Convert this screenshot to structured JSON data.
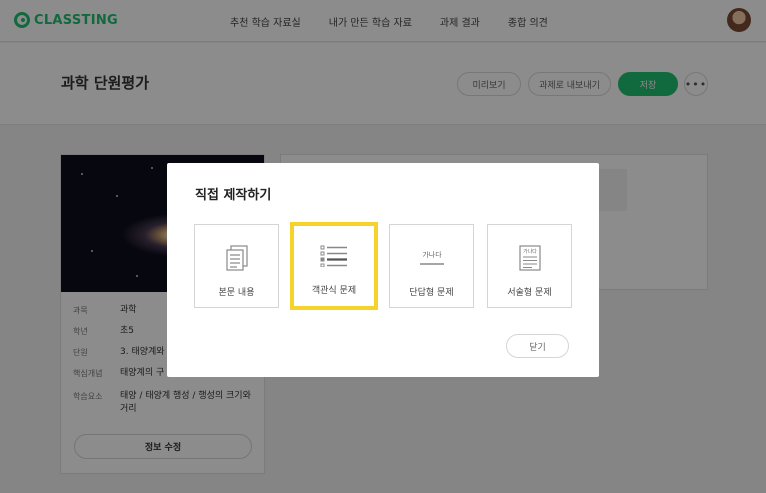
{
  "nav": {
    "logo_text": "CLASSTING",
    "menu": [
      "추천 학습 자료실",
      "내가 만든 학습 자료",
      "과제 결과",
      "종합 의견"
    ]
  },
  "header": {
    "title": "과학 단원평가",
    "preview_label": "미리보기",
    "export_label": "과제로 내보내기",
    "save_label": "저장",
    "more_label": "•••"
  },
  "card": {
    "fields": [
      {
        "key": "과목",
        "value": "과학"
      },
      {
        "key": "학년",
        "value": "초5"
      },
      {
        "key": "단원",
        "value": "3. 태양계와"
      },
      {
        "key": "핵심개념",
        "value": "태양계의 구"
      },
      {
        "key": "학습요소",
        "value": "태양 / 태양계 행성 / 행성의 크기와 거리"
      }
    ],
    "edit_label": "정보 수정"
  },
  "modal": {
    "title": "직접 제작하기",
    "options": [
      {
        "label": "본문 내용",
        "icon": "document-icon"
      },
      {
        "label": "객관식 문제",
        "icon": "multiple-choice-icon"
      },
      {
        "label": "단답형 문제",
        "icon": "short-answer-icon",
        "icon_text": "가나다"
      },
      {
        "label": "서술형 문제",
        "icon": "essay-icon",
        "icon_text": "가나다"
      }
    ],
    "selected_index": 1,
    "close_label": "닫기"
  },
  "colors": {
    "brand": "#1fbf72",
    "selected_border": "#f6d32c"
  }
}
